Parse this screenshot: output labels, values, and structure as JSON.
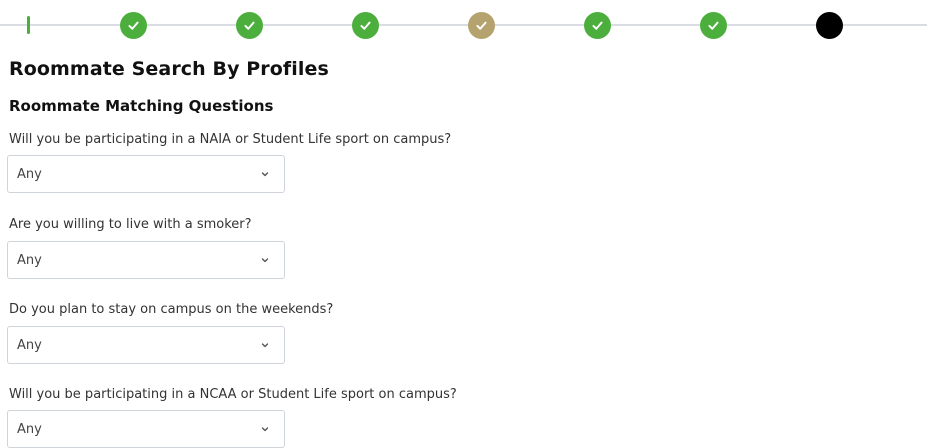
{
  "stepper": {
    "steps": [
      {
        "state": "done"
      },
      {
        "state": "done"
      },
      {
        "state": "done"
      },
      {
        "state": "current"
      },
      {
        "state": "done"
      },
      {
        "state": "done"
      },
      {
        "state": "upcoming"
      }
    ],
    "colors": {
      "done": "#4cae3c",
      "current": "#b5a36f",
      "upcoming": "#000000",
      "track": "#d9dde3"
    }
  },
  "page": {
    "title": "Roommate Search By Profiles",
    "section_title": "Roommate Matching Questions"
  },
  "questions": [
    {
      "label": "Will you be participating in a NAIA or Student Life sport on campus?",
      "value": "Any"
    },
    {
      "label": "Are you willing to live with a smoker?",
      "value": "Any"
    },
    {
      "label": "Do you plan to stay on campus on the weekends?",
      "value": "Any"
    },
    {
      "label": "Will you be participating in a NCAA or Student Life sport on campus?",
      "value": "Any"
    }
  ],
  "icons": {
    "step_done": "check-icon",
    "select_arrow": "chevron-down-icon"
  }
}
